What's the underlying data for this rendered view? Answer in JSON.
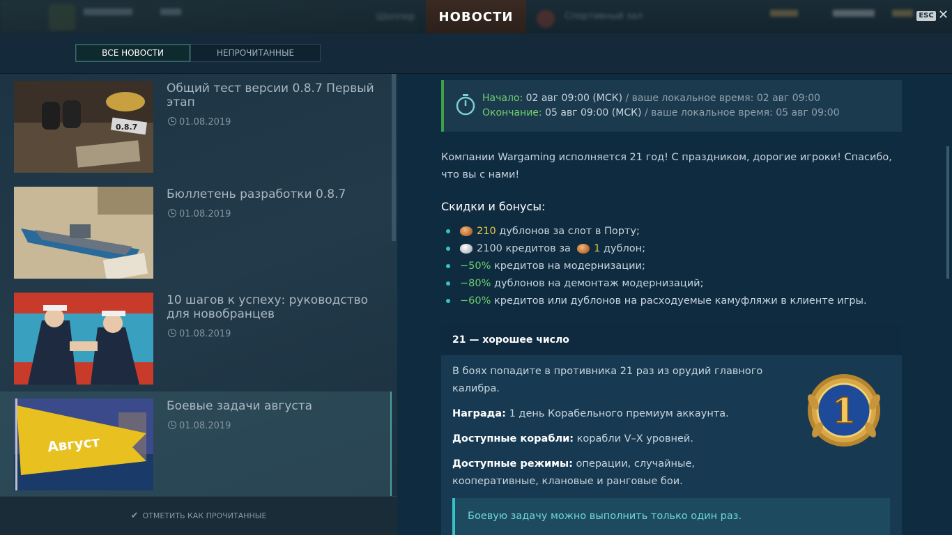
{
  "header": {
    "blurred_left": "Шоппер",
    "blurred_center": "Спортивный зал",
    "news_tab": "НОВОСТИ",
    "esc_label": "ESC",
    "close_label": "✕"
  },
  "filters": {
    "all": "ВСЕ НОВОСТИ",
    "unread": "НЕПРОЧИТАННЫЕ"
  },
  "news_list": [
    {
      "title": "Общий тест версии 0.8.7 Первый этап",
      "date": "01.08.2019"
    },
    {
      "title": "Бюллетень разработки 0.8.7",
      "date": "01.08.2019"
    },
    {
      "title": "10 шагов к успеху: руководство для новобранцев",
      "date": "01.08.2019"
    },
    {
      "title": "Боевые задачи августа",
      "date": "01.08.2019"
    }
  ],
  "thumbs": {
    "version_badge": "0.8.7",
    "flag_text": "Август"
  },
  "footer": {
    "mark_read": "ОТМЕТИТЬ КАК ПРОЧИТАННЫЕ"
  },
  "article": {
    "start_label": "Начало:",
    "start_value": "02 авг 09:00 (МСК)",
    "start_local": "/ ваше локальное время: 02 авг 09:00",
    "end_label": "Окончание:",
    "end_value": "05 авг 09:00 (МСК)",
    "end_local": "/ ваше локальное время: 05 авг 09:00",
    "intro": "Компании Wargaming исполняется 21 год! С праздником, дорогие игроки! Спасибо, что вы с нами!",
    "discounts_heading": "Скидки и бонусы:",
    "b1_num": "210",
    "b1_text": "дублонов за слот в Порту;",
    "b2_text": "2100 кредитов за",
    "b2_num": "1",
    "b2_tail": "дублон;",
    "b3_pct": "−50%",
    "b3_text": "кредитов на модернизации;",
    "b4_pct": "−80%",
    "b4_text": "дублонов на демонтаж модернизаций;",
    "b5_pct": "−60%",
    "b5_text": "кредитов или дублонов на расходуемые камуфляжи в клиенте игры.",
    "card_title": "21 — хорошее число",
    "card_text": "В боях попадите в противника 21 раз из орудий главного калибра.",
    "reward_label": "Награда:",
    "reward_value": "1 день Корабельного премиум аккаунта.",
    "ships_label": "Доступные корабли:",
    "ships_value": "корабли V–X уровней.",
    "modes_label": "Доступные режимы:",
    "modes_value": "операции, случайные, кооперативные, клановые и ранговые бои.",
    "medal_num": "1",
    "note": "Боевую задачу можно выполнить только один раз."
  },
  "colors": {
    "accent_teal": "#35c3c3",
    "accent_green": "#3ca048",
    "label_green": "#6fd06f",
    "coin_gold": "#e8c84a"
  }
}
